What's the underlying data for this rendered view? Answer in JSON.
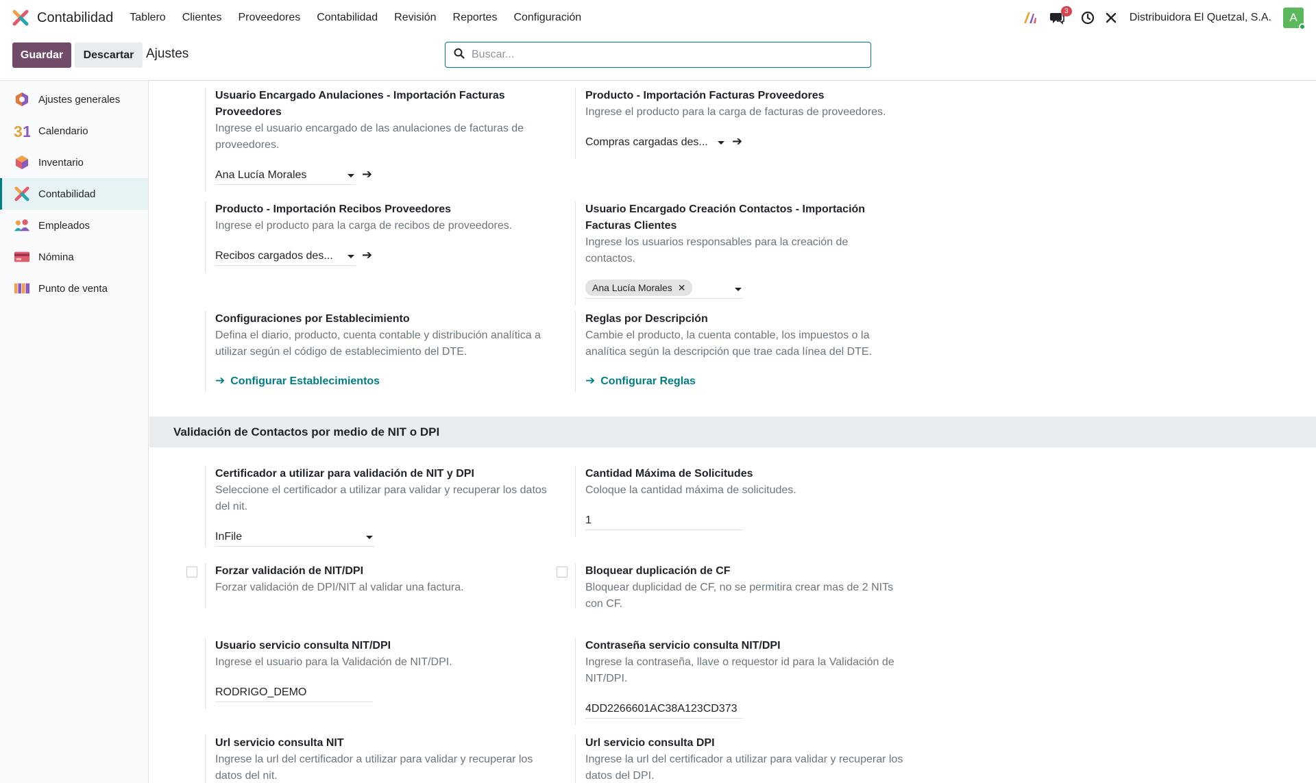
{
  "app": {
    "name": "Contabilidad",
    "menu": [
      "Tablero",
      "Clientes",
      "Proveedores",
      "Contabilidad",
      "Revisión",
      "Reportes",
      "Configuración"
    ],
    "message_count": "3",
    "company": "Distribuidora El Quetzal, S.A.",
    "avatar_letter": "A"
  },
  "control": {
    "save_label": "Guardar",
    "discard_label": "Descartar",
    "title": "Ajustes",
    "search_placeholder": "Buscar..."
  },
  "sidebar": {
    "items": [
      {
        "label": "Ajustes generales",
        "icon": "settings-hexagon-icon"
      },
      {
        "label": "Calendario",
        "icon": "calendar-31-icon"
      },
      {
        "label": "Inventario",
        "icon": "inventory-cube-icon"
      },
      {
        "label": "Contabilidad",
        "icon": "accounting-icon"
      },
      {
        "label": "Empleados",
        "icon": "employees-icon"
      },
      {
        "label": "Nómina",
        "icon": "payroll-card-icon"
      },
      {
        "label": "Punto de venta",
        "icon": "shop-awning-icon"
      }
    ],
    "active_index": 3
  },
  "settings": {
    "anulaciones": {
      "title": "Usuario Encargado Anulaciones - Importación Facturas Proveedores",
      "desc": "Ingrese el usuario encargado de las anulaciones de facturas de proveedores.",
      "value": "Ana Lucía Morales"
    },
    "producto_facturas": {
      "title": "Producto - Importación Facturas Proveedores",
      "desc": "Ingrese el producto para la carga de facturas de proveedores.",
      "value": "Compras cargadas des..."
    },
    "producto_recibos": {
      "title": "Producto - Importación Recibos Proveedores",
      "desc": "Ingrese el producto para la carga de recibos de proveedores.",
      "value": "Recibos cargados des..."
    },
    "creacion_contactos": {
      "title": "Usuario Encargado Creación Contactos - Importación Facturas Clientes",
      "desc": "Ingrese los usuarios responsables para la creación de contactos.",
      "tag": "Ana Lucía Morales"
    },
    "establecimientos": {
      "title": "Configuraciones por Establecimiento",
      "desc": "Defina el diario, producto, cuenta contable y distribución analítica a utilizar según el código de establecimiento del DTE.",
      "link": "Configurar Establecimientos"
    },
    "reglas": {
      "title": "Reglas por Descripción",
      "desc": "Cambie el producto, la cuenta contable, los impuestos o la analítica según la descripción que trae cada línea del DTE.",
      "link": "Configurar Reglas"
    },
    "section_title": "Validación de Contactos por medio de NIT o DPI",
    "certificador": {
      "title": "Certificador a utilizar para validación de NIT y DPI",
      "desc": "Seleccione el certificador a utilizar para validar y recuperar los datos del nit.",
      "value": "InFile"
    },
    "cantidad_max": {
      "title": "Cantidad Máxima de Solicitudes",
      "desc": "Coloque la cantidad máxima de solicitudes.",
      "value": "1"
    },
    "forzar": {
      "title": "Forzar validación de NIT/DPI",
      "desc": "Forzar validación de DPI/NIT al validar una factura."
    },
    "bloquear": {
      "title": "Bloquear duplicación de CF",
      "desc": "Bloquear duplicidad de CF, no se permitira crear mas de 2 NITs con CF."
    },
    "usuario_servicio": {
      "title": "Usuario servicio consulta NIT/DPI",
      "desc": "Ingrese el usuario para la Validación de NIT/DPI.",
      "value": "RODRIGO_DEMO"
    },
    "password_servicio": {
      "title": "Contraseña servicio consulta NIT/DPI",
      "desc": "Ingrese la contraseña, llave o requestor id para la Validación de NIT/DPI.",
      "value": "4DD2266601AC38A123CD373"
    },
    "url_nit": {
      "title": "Url servicio consulta NIT",
      "desc": "Ingrese la url del certificador a utilizar para validar y recuperar los datos del nit."
    },
    "url_dpi": {
      "title": "Url servicio consulta DPI",
      "desc": "Ingrese la url del certificador a utilizar para validar y recuperar los datos del DPI."
    }
  },
  "colors": {
    "primary": "#714b67",
    "accent": "#017e84"
  }
}
